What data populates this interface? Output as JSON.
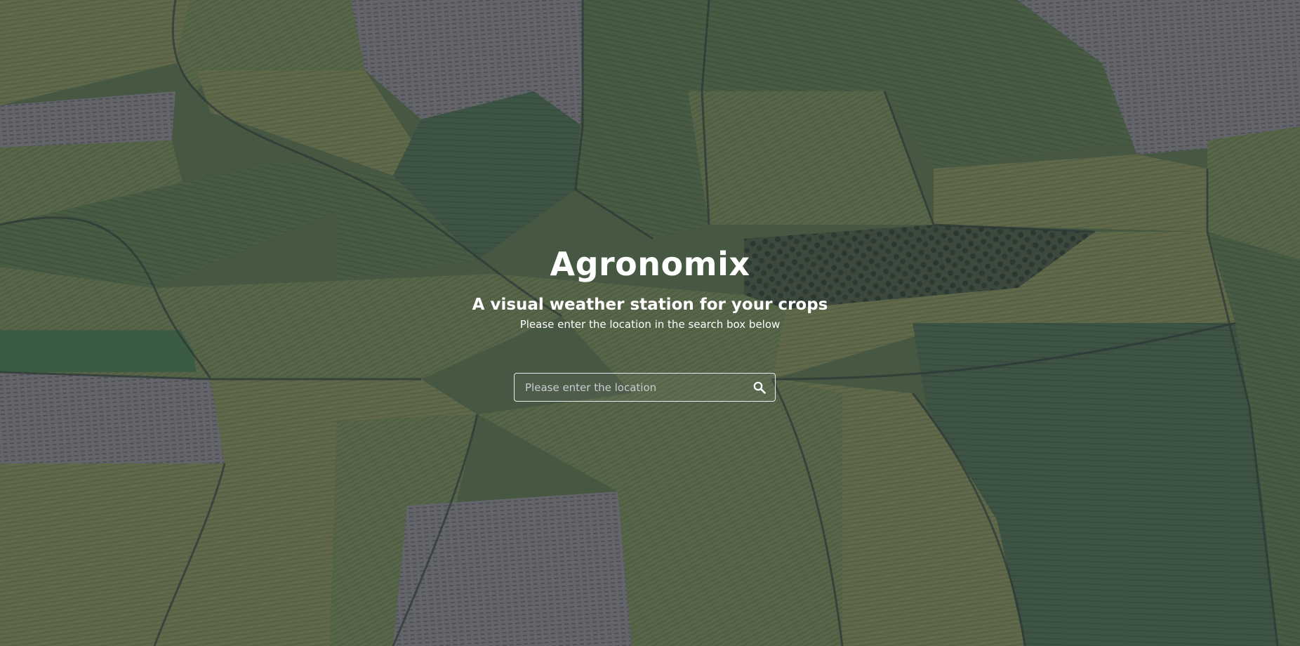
{
  "app": {
    "title": "Agronomix",
    "subtitle": "A visual weather station for your crops",
    "hint": "Please enter the location in the search box below"
  },
  "search": {
    "placeholder": "Please enter the location",
    "value": "",
    "icon": "search-icon"
  },
  "background": {
    "description_icon": "aerial-farmland-image",
    "overlay_color": "#263252"
  }
}
